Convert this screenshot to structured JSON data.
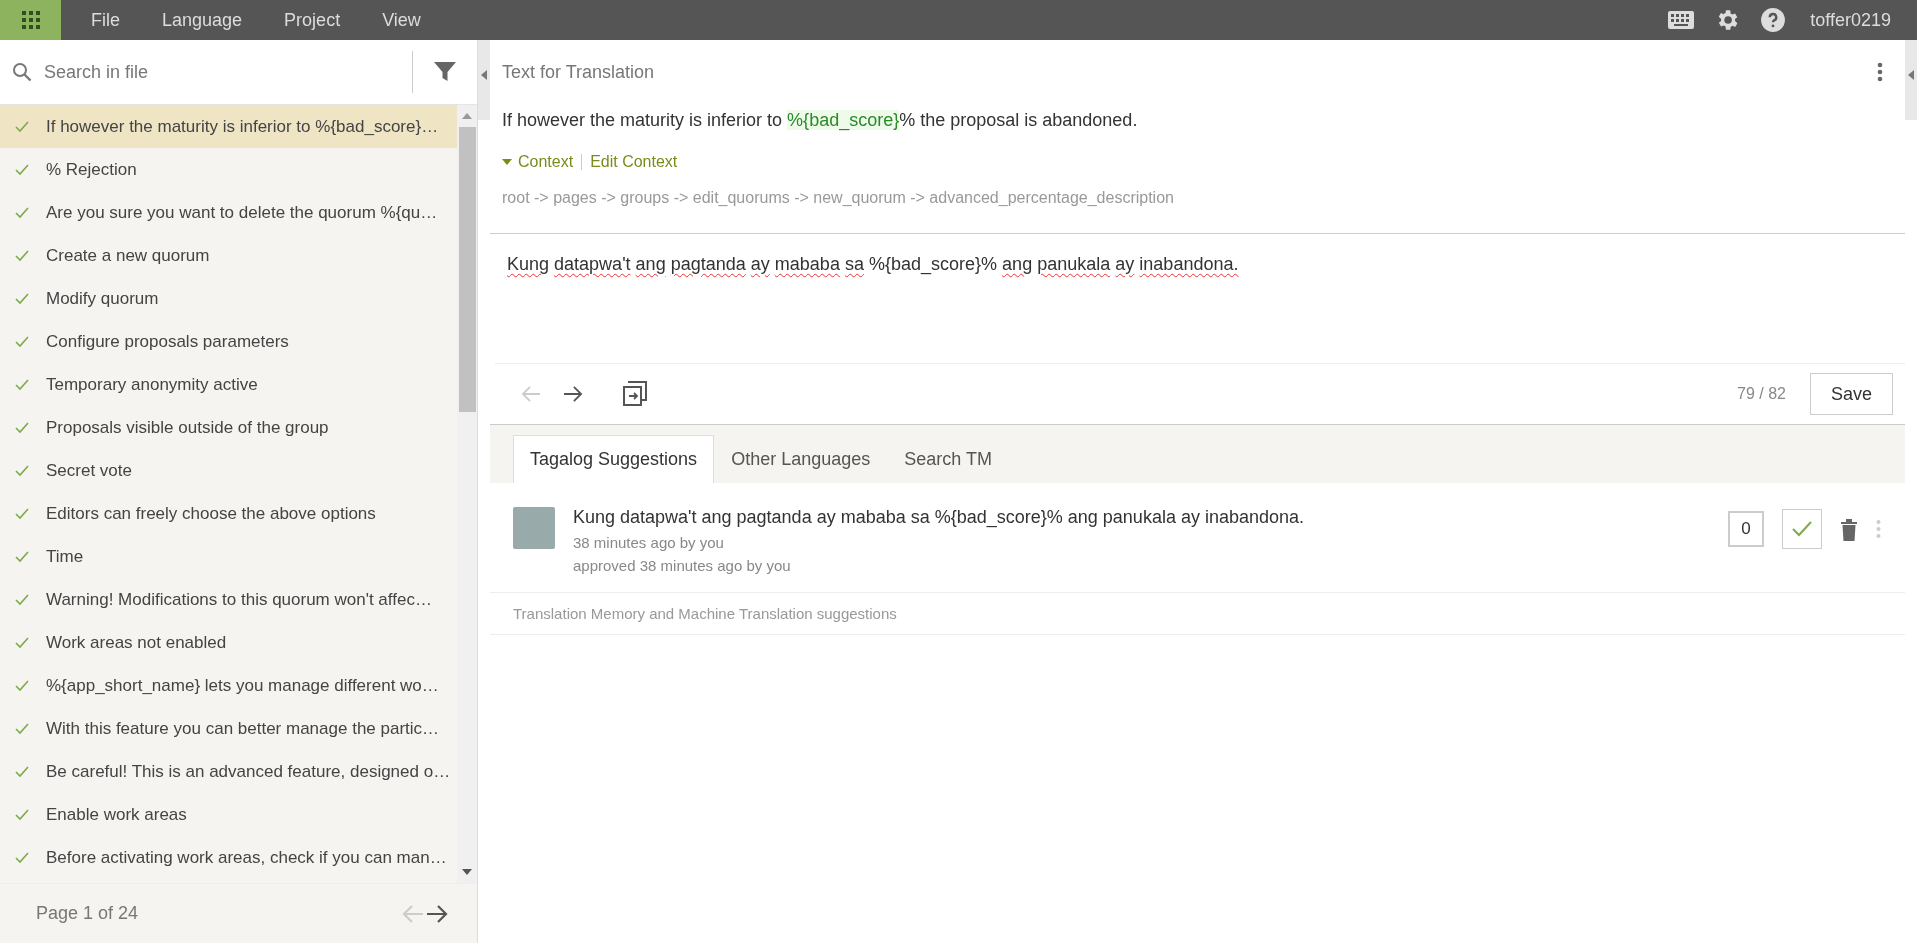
{
  "menu": {
    "items": [
      "File",
      "Language",
      "Project",
      "View"
    ],
    "user": "toffer0219"
  },
  "sidebar": {
    "search": {
      "placeholder": "Search in file"
    },
    "items": [
      {
        "text": "If however the maturity is inferior to %{bad_score}…",
        "translated": true,
        "selected": true
      },
      {
        "text": "% Rejection",
        "translated": true,
        "selected": false
      },
      {
        "text": "Are you sure you want to delete the quorum %{qu…",
        "translated": true,
        "selected": false
      },
      {
        "text": "Create a new quorum",
        "translated": true,
        "selected": false
      },
      {
        "text": "Modify quorum",
        "translated": true,
        "selected": false
      },
      {
        "text": "Configure proposals parameters",
        "translated": true,
        "selected": false
      },
      {
        "text": "Temporary anonymity active",
        "translated": true,
        "selected": false
      },
      {
        "text": "Proposals visible outside of the group",
        "translated": true,
        "selected": false
      },
      {
        "text": "Secret vote",
        "translated": true,
        "selected": false
      },
      {
        "text": "Editors can freely choose the above options",
        "translated": true,
        "selected": false
      },
      {
        "text": "Time",
        "translated": true,
        "selected": false
      },
      {
        "text": "Warning! Modifications to this quorum won't affec…",
        "translated": true,
        "selected": false
      },
      {
        "text": "Work areas not enabled",
        "translated": true,
        "selected": false
      },
      {
        "text": "%{app_short_name} lets you manage different wo…",
        "translated": true,
        "selected": false
      },
      {
        "text": "With this feature you can better manage the partic…",
        "translated": true,
        "selected": false
      },
      {
        "text": "Be careful! This is an advanced feature, designed o…",
        "translated": true,
        "selected": false
      },
      {
        "text": "Enable work areas",
        "translated": true,
        "selected": false
      },
      {
        "text": "Before activating work areas, check if you can man…",
        "translated": true,
        "selected": false
      }
    ],
    "pager": {
      "label": "Page 1 of 24",
      "prev_disabled": true,
      "next_disabled": false
    }
  },
  "editor": {
    "title": "Text for Translation",
    "source": [
      {
        "kind": "plain",
        "text": "If however the maturity is inferior to "
      },
      {
        "kind": "placeholder",
        "text": "%{bad_score}"
      },
      {
        "kind": "plain",
        "text": "% the proposal is abandoned."
      }
    ],
    "context": {
      "toggle": "Context",
      "edit": "Edit Context",
      "path": "root -> pages -> groups -> edit_quorums -> new_quorum -> advanced_percentage_description"
    },
    "translation": [
      {
        "text": "Kung",
        "misspelled": true
      },
      {
        "text": "datapwa't",
        "misspelled": true
      },
      {
        "text": "ang",
        "misspelled": true
      },
      {
        "text": "pagtanda",
        "misspelled": true
      },
      {
        "text": "ay",
        "misspelled": true
      },
      {
        "text": "mababa",
        "misspelled": true
      },
      {
        "text": "sa",
        "misspelled": true
      },
      {
        "text": "%{bad_score}%",
        "misspelled": false
      },
      {
        "text": "ang",
        "misspelled": true
      },
      {
        "text": "panukala",
        "misspelled": true
      },
      {
        "text": "ay",
        "misspelled": true
      },
      {
        "text": "inabandona.",
        "misspelled": true
      }
    ],
    "prev_disabled": true,
    "next_disabled": false,
    "counter": "79 / 82",
    "save": "Save"
  },
  "tabs": [
    {
      "label": "Tagalog Suggestions",
      "selected": true
    },
    {
      "label": "Other Languages",
      "selected": false
    },
    {
      "label": "Search TM",
      "selected": false
    }
  ],
  "suggestions": [
    {
      "text": "Kung datapwa't ang pagtanda ay mababa sa %{bad_score}% ang panukala ay inabandona.",
      "meta": "38 minutes ago by you",
      "approval": "approved 38 minutes ago by you",
      "votes": "0",
      "approved": true
    }
  ],
  "tm_label": "Translation Memory and Machine Translation suggestions"
}
